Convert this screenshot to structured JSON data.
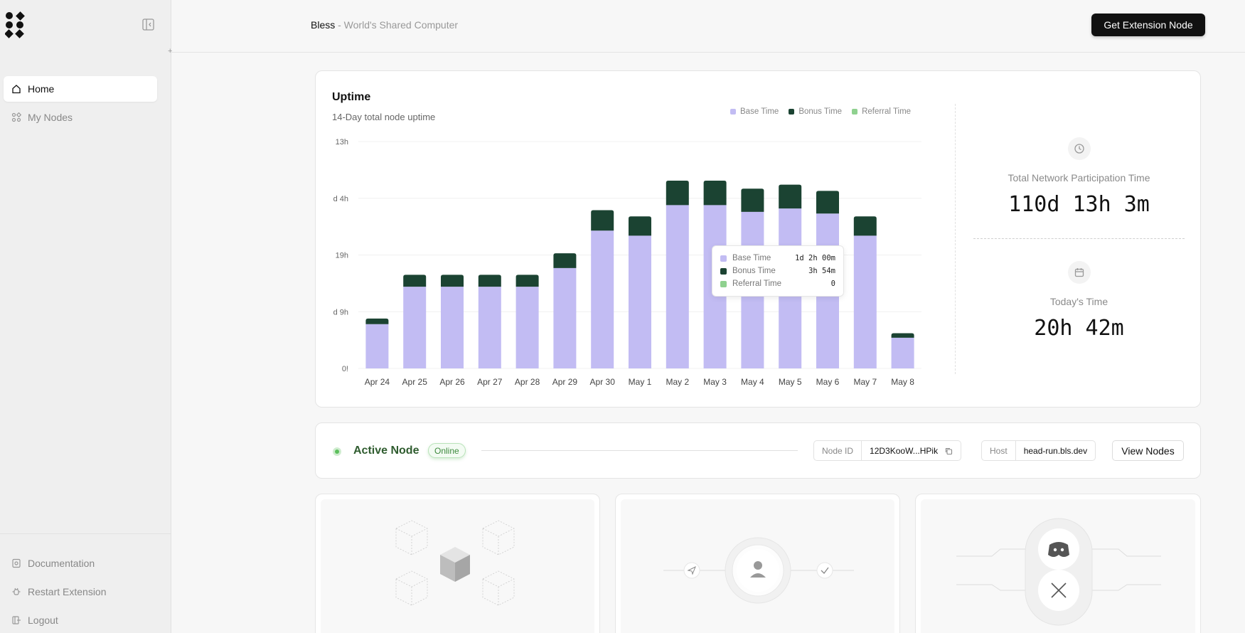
{
  "sidebar": {
    "items": [
      {
        "label": "Home",
        "icon": "home-icon",
        "active": true
      },
      {
        "label": "My Nodes",
        "icon": "nodes-icon",
        "active": false
      }
    ],
    "bottom_items": [
      {
        "label": "Documentation",
        "icon": "documentation-icon"
      },
      {
        "label": "Restart Extension",
        "icon": "restart-icon"
      },
      {
        "label": "Logout",
        "icon": "logout-icon"
      }
    ]
  },
  "header": {
    "brand": "Bless",
    "subtitle": " - World's Shared Computer",
    "cta_label": "Get Extension Node"
  },
  "uptime": {
    "title": "Uptime",
    "subtitle": "14-Day total node uptime",
    "legend": [
      {
        "label": "Base Time",
        "color": "#c2bcf3"
      },
      {
        "label": "Bonus Time",
        "color": "#1b4332"
      },
      {
        "label": "Referral Time",
        "color": "#8fd18f"
      }
    ],
    "tooltip": {
      "rows": [
        {
          "label": "Base Time",
          "value": "1d 2h 00m",
          "color": "#c2bcf3"
        },
        {
          "label": "Bonus Time",
          "value": "3h 54m",
          "color": "#1b4332"
        },
        {
          "label": "Referral Time",
          "value": "0",
          "color": "#8fd18f"
        }
      ]
    }
  },
  "chart_data": {
    "type": "bar",
    "stacked": true,
    "categories": [
      "Apr 24",
      "Apr 25",
      "Apr 26",
      "Apr 27",
      "Apr 28",
      "Apr 29",
      "Apr 30",
      "May 1",
      "May 2",
      "May 3",
      "May 4",
      "May 5",
      "May 6",
      "May 7",
      "May 8"
    ],
    "y_tick_labels": [
      "0!",
      "d 9h",
      "19h",
      "d 4h",
      "13h"
    ],
    "ylim": [
      0,
      40
    ],
    "series": [
      {
        "name": "Base Time",
        "color": "#c2bcf3",
        "values": [
          7.8,
          14.4,
          14.4,
          14.4,
          14.4,
          17.7,
          24.3,
          23.4,
          28.8,
          28.8,
          27.6,
          28.2,
          27.3,
          23.4,
          5.4
        ]
      },
      {
        "name": "Bonus Time",
        "color": "#1b4332",
        "values": [
          1.0,
          2.1,
          2.1,
          2.1,
          2.1,
          2.6,
          3.6,
          3.4,
          4.3,
          4.3,
          4.1,
          4.2,
          4.0,
          3.4,
          0.8
        ]
      },
      {
        "name": "Referral Time",
        "color": "#8fd18f",
        "values": [
          0,
          0,
          0,
          0,
          0,
          0,
          0,
          0,
          0,
          0,
          0,
          0,
          0,
          0,
          0
        ]
      }
    ],
    "grid": true,
    "legend_position": "top-right"
  },
  "stats": {
    "total_label": "Total Network Participation Time",
    "total_value": "110d 13h 3m",
    "today_label": "Today's Time",
    "today_value": "20h 42m"
  },
  "node": {
    "title": "Active Node",
    "status": "Online",
    "node_id_label": "Node ID",
    "node_id_value": "12D3KooW...HPik",
    "host_label": "Host",
    "host_value": "head-run.bls.dev",
    "view_label": "View Nodes"
  }
}
